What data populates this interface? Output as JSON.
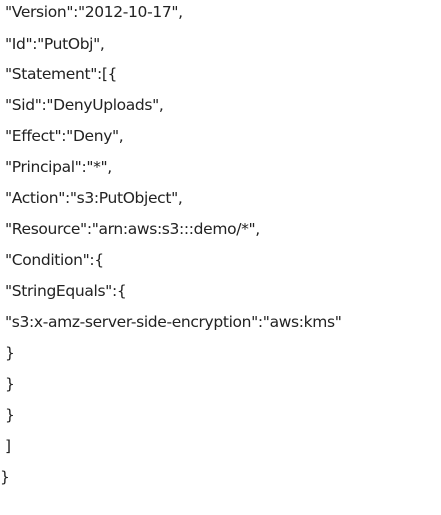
{
  "document": {
    "lines": [
      "\"Version\":\"2012-10-17\",",
      "\"Id\":\"PutObj\",",
      "\"Statement\":[{",
      "\"Sid\":\"DenyUploads\",",
      "\"Effect\":\"Deny\",",
      "\"Principal\":\"*\",",
      "\"Action\":\"s3:PutObject\",",
      "\"Resource\":\"arn:aws:s3:::demo/*\",",
      "\"Condition\":{",
      "\"StringEquals\":{",
      "\"s3:x-amz-server-side-encryption\":\"aws:kms\"",
      "}",
      "}",
      "}",
      "]",
      "}"
    ]
  }
}
